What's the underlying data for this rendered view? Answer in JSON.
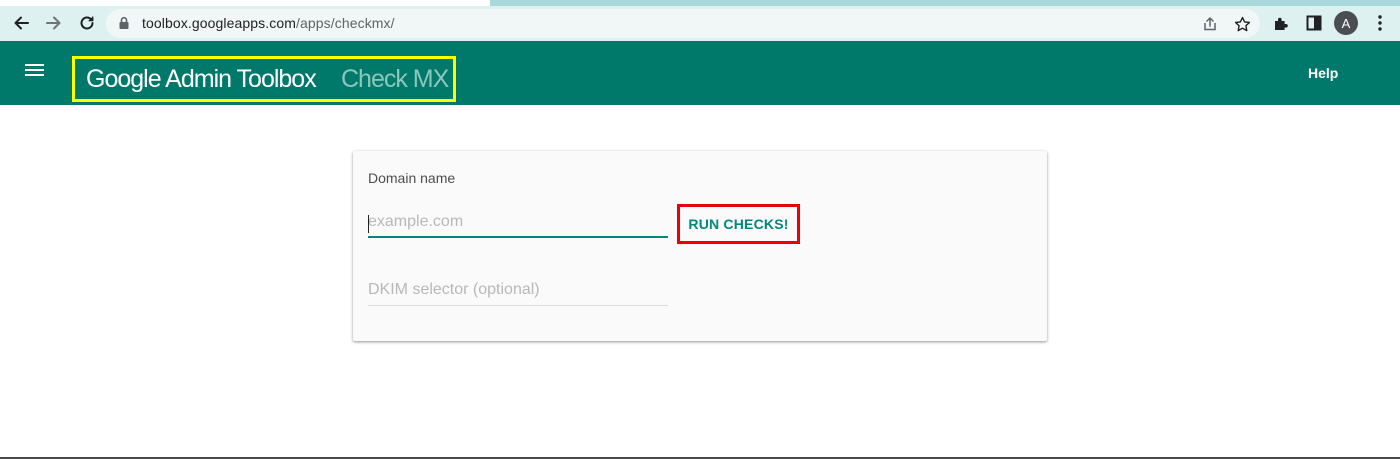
{
  "browser": {
    "url_domain": "toolbox.googleapps.com",
    "url_path": "/apps/checkmx/",
    "profile_initial": "A",
    "icons": [
      "back-arrow-icon",
      "forward-arrow-icon",
      "reload-icon",
      "lock-icon",
      "share-icon",
      "star-icon",
      "extensions-puzzle-icon",
      "side-panel-icon",
      "kebab-menu-icon"
    ]
  },
  "appbar": {
    "title": "Google Admin Toolbox",
    "subtitle": "Check MX",
    "help_label": "Help",
    "menu_icon": "hamburger-menu-icon",
    "color": "#00796b"
  },
  "form": {
    "domain_label": "Domain name",
    "domain_placeholder": "example.com",
    "domain_value": "",
    "run_button_label": "RUN CHECKS!",
    "dkim_placeholder": "DKIM selector (optional)",
    "dkim_value": ""
  },
  "colors": {
    "accent": "#00897b",
    "title_highlight": "#ffff00",
    "button_highlight": "#e8000b"
  }
}
